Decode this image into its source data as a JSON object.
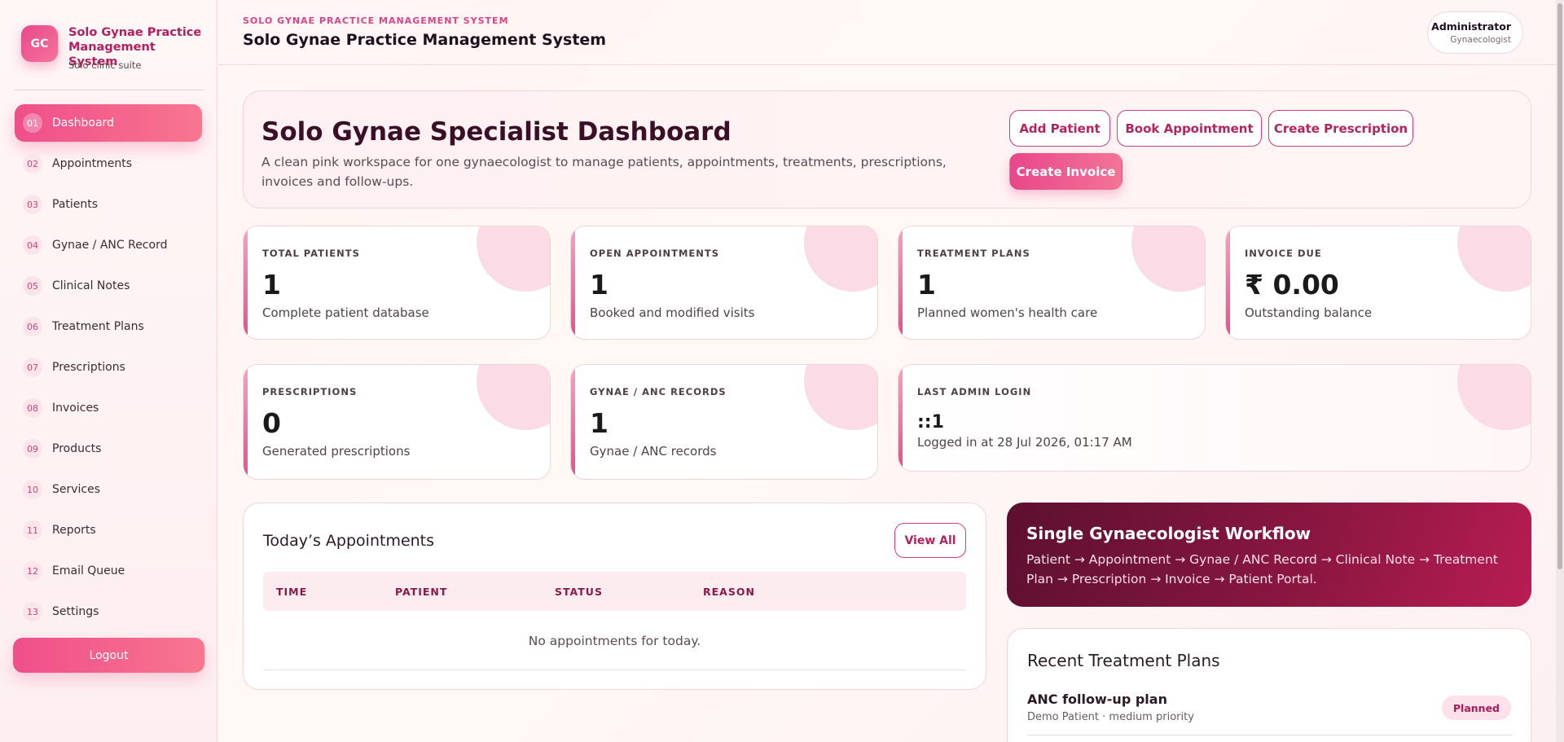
{
  "brand": {
    "logo": "GC",
    "title": "Solo Gynae Practice Management System",
    "subtitle": "Solo clinic suite"
  },
  "sidebar": {
    "items": [
      {
        "num": "01",
        "label": "Dashboard",
        "active": true
      },
      {
        "num": "02",
        "label": "Appointments"
      },
      {
        "num": "03",
        "label": "Patients"
      },
      {
        "num": "04",
        "label": "Gynae / ANC Record"
      },
      {
        "num": "05",
        "label": "Clinical Notes"
      },
      {
        "num": "06",
        "label": "Treatment Plans"
      },
      {
        "num": "07",
        "label": "Prescriptions"
      },
      {
        "num": "08",
        "label": "Invoices"
      },
      {
        "num": "09",
        "label": "Products"
      },
      {
        "num": "10",
        "label": "Services"
      },
      {
        "num": "11",
        "label": "Reports"
      },
      {
        "num": "12",
        "label": "Email Queue"
      },
      {
        "num": "13",
        "label": "Settings"
      }
    ],
    "logout_label": "Logout"
  },
  "header": {
    "eyebrow": "SOLO GYNAE PRACTICE MANAGEMENT SYSTEM",
    "title": "Solo Gynae Practice Management System",
    "user_name": "Administrator",
    "user_role": "Gynaecologist"
  },
  "hero": {
    "title": "Solo Gynae Specialist Dashboard",
    "description": "A clean pink workspace for one gynaecologist to manage patients, appointments, treatments, prescriptions, invoices and follow-ups.",
    "buttons": {
      "add_patient": "Add Patient",
      "book_appointment": "Book Appointment",
      "create_prescription": "Create Prescription",
      "create_invoice": "Create Invoice"
    }
  },
  "stats": {
    "total_patients": {
      "label": "TOTAL PATIENTS",
      "value": "1",
      "sub": "Complete patient database"
    },
    "open_appointments": {
      "label": "OPEN APPOINTMENTS",
      "value": "1",
      "sub": "Booked and modified visits"
    },
    "treatment_plans": {
      "label": "TREATMENT PLANS",
      "value": "1",
      "sub": "Planned women's health care"
    },
    "invoice_due": {
      "label": "INVOICE DUE",
      "value": "₹ 0.00",
      "sub": "Outstanding balance"
    },
    "prescriptions": {
      "label": "PRESCRIPTIONS",
      "value": "0",
      "sub": "Generated prescriptions"
    },
    "anc_records": {
      "label": "GYNAE / ANC RECORDS",
      "value": "1",
      "sub": "Gynae / ANC records"
    },
    "last_login": {
      "label": "LAST ADMIN LOGIN",
      "value": "::1",
      "sub": "Logged in at 28 Jul 2026, 01:17 AM"
    }
  },
  "appointments": {
    "title": "Today’s Appointments",
    "view_all": "View All",
    "columns": [
      "TIME",
      "PATIENT",
      "STATUS",
      "REASON"
    ],
    "empty": "No appointments for today."
  },
  "workflow": {
    "title": "Single Gynaecologist Workflow",
    "description": "Patient → Appointment → Gynae / ANC Record → Clinical Note → Treatment Plan → Prescription → Invoice → Patient Portal."
  },
  "plans": {
    "title": "Recent Treatment Plans",
    "items": [
      {
        "name": "ANC follow-up plan",
        "meta": "Demo Patient · medium priority",
        "badge": "Planned"
      }
    ]
  },
  "colors": {
    "accent": "#e64a8b",
    "dark": "#5c1030"
  }
}
